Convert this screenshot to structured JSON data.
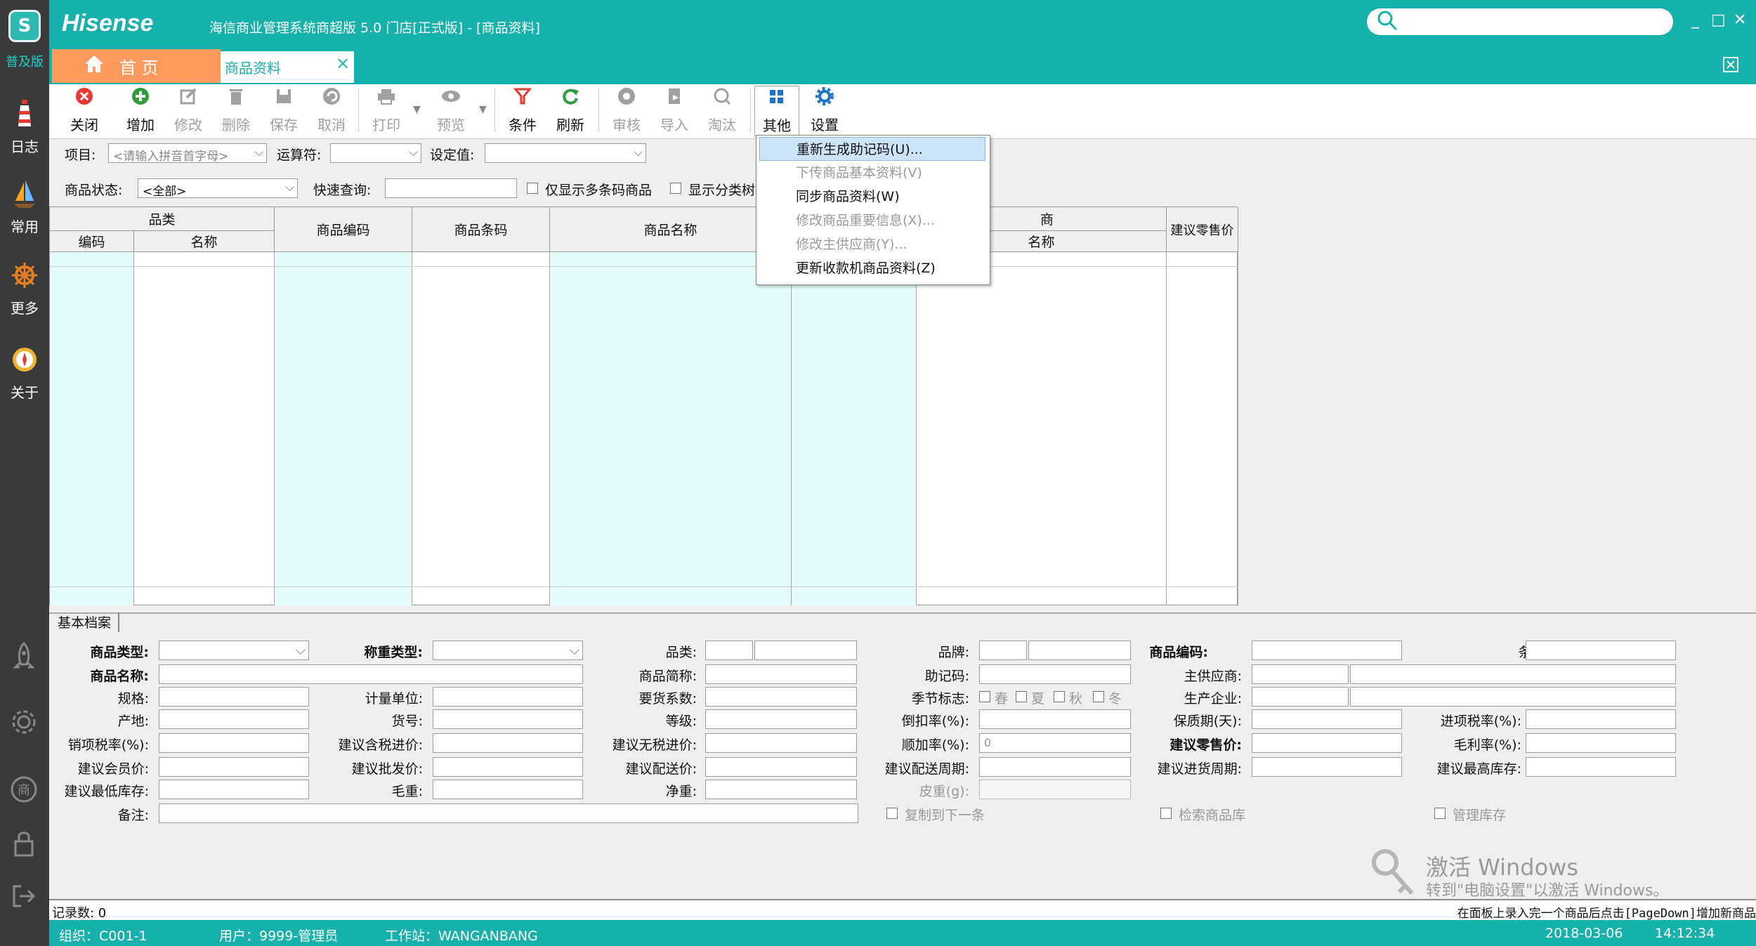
{
  "window": {
    "brand": "Hisense",
    "title": "海信商业管理系统商超版 5.0 门店[正式版] - [商品资料]",
    "search_placeholder": "",
    "minimize": "_",
    "maximize": "□",
    "close": "✕"
  },
  "sidebar": {
    "logo": "S",
    "edition": "普及版",
    "items": [
      {
        "label": "日志",
        "icon": "lighthouse-icon"
      },
      {
        "label": "常用",
        "icon": "sailboat-icon"
      },
      {
        "label": "更多",
        "icon": "helm-icon"
      },
      {
        "label": "关于",
        "icon": "compass-icon"
      }
    ],
    "bottom_icons": [
      "rocket-icon",
      "gear-icon",
      "shop-icon",
      "lock-icon",
      "exit-icon"
    ],
    "shop_glyph": "商"
  },
  "tabs": {
    "home": "首 页",
    "current": "商品资料",
    "close": "×"
  },
  "toolbar": {
    "items": [
      {
        "label": "关闭",
        "icon": "close-circle-icon",
        "enabled": true
      },
      {
        "label": "增加",
        "icon": "add-icon",
        "enabled": true
      },
      {
        "label": "修改",
        "icon": "edit-icon",
        "enabled": false
      },
      {
        "label": "删除",
        "icon": "trash-icon",
        "enabled": false
      },
      {
        "label": "保存",
        "icon": "save-icon",
        "enabled": false
      },
      {
        "label": "取消",
        "icon": "undo-icon",
        "enabled": false
      },
      {
        "label": "打印",
        "icon": "printer-icon",
        "enabled": false
      },
      {
        "label": "预览",
        "icon": "eye-icon",
        "enabled": false
      },
      {
        "label": "条件",
        "icon": "filter-icon",
        "enabled": true
      },
      {
        "label": "刷新",
        "icon": "refresh-icon",
        "enabled": true
      },
      {
        "label": "审核",
        "icon": "audit-icon",
        "enabled": false
      },
      {
        "label": "导入",
        "icon": "import-icon",
        "enabled": false
      },
      {
        "label": "淘汰",
        "icon": "search-icon",
        "enabled": false
      },
      {
        "label": "其他",
        "icon": "grid-icon",
        "enabled": true
      },
      {
        "label": "设置",
        "icon": "gear-icon",
        "enabled": true
      }
    ],
    "colors": {
      "red": "#e53935",
      "green": "#2e9d3a",
      "gray": "#a0a0a0",
      "blue": "#1e74c8"
    }
  },
  "filter": {
    "project_label": "项目:",
    "project_placeholder": "<请输入拼音首字母>",
    "operator_label": "运算符:",
    "operator_value": "",
    "value_label": "设定值:",
    "value_value": "",
    "status_label": "商品状态:",
    "status_value": "<全部>",
    "quick_label": "快速查询:",
    "quick_value": "",
    "multi_barcode": "仅显示多条码商品",
    "show_tree": "显示分类树"
  },
  "grid": {
    "group_category": "品类",
    "col_code": "编码",
    "col_name": "名称",
    "col_product_code": "商品编码",
    "col_barcode": "商品条码",
    "col_product_name": "商品名称",
    "group_supplier": "商",
    "col_supplier_name": "名称",
    "col_price": "建议零售价"
  },
  "menu": {
    "items": [
      {
        "label": "重新生成助记码(U)...",
        "enabled": true,
        "highlighted": true
      },
      {
        "label": "下传商品基本资料(V)",
        "enabled": false
      },
      {
        "label": "同步商品资料(W)",
        "enabled": true
      },
      {
        "label": "修改商品重要信息(X)...",
        "enabled": false
      },
      {
        "label": "修改主供应商(Y)...",
        "enabled": false
      },
      {
        "label": "更新收款机商品资料(Z)",
        "enabled": true
      }
    ]
  },
  "detail": {
    "tab": "基本档案",
    "labels": {
      "product_type": "商品类型:",
      "weigh_type": "称重类型:",
      "category": "品类:",
      "brand": "品牌:",
      "product_code": "商品编码:",
      "barcode": "条码:",
      "product_name": "商品名称:",
      "short_name": "商品简称:",
      "mnemonic": "助记码:",
      "main_supplier": "主供应商:",
      "spec": "规格:",
      "unit": "计量单位:",
      "conversion": "要货系数:",
      "season": "季节标志:",
      "manufacturer": "生产企业:",
      "origin": "产地:",
      "article_no": "货号:",
      "grade": "等级:",
      "deduct_rate": "倒扣率(%):",
      "shelf_life": "保质期(天):",
      "input_tax": "进项税率(%):",
      "output_tax": "销项税率(%):",
      "tax_purchase": "建议含税进价:",
      "notax_purchase": "建议无税进价:",
      "markup_rate": "顺加率(%):",
      "retail_price": "建议零售价:",
      "gross_rate": "毛利率(%):",
      "member_price": "建议会员价:",
      "wholesale_price": "建议批发价:",
      "delivery_price": "建议配送价:",
      "delivery_cycle": "建议配送周期:",
      "purchase_cycle": "建议进货周期:",
      "max_stock": "建议最高库存:",
      "min_stock": "建议最低库存:",
      "gross_weight": "毛重:",
      "net_weight": "净重:",
      "tare": "皮重(g):",
      "remark": "备注:"
    },
    "seasons": [
      "春",
      "夏",
      "秋",
      "冬"
    ],
    "markup_value": "0",
    "copy_next": "复制到下一条",
    "check_store": "检索商品库",
    "manage_stock": "管理库存"
  },
  "watermark": {
    "line1": "激活 Windows",
    "line2": "转到\"电脑设置\"以激活 Windows。"
  },
  "status": {
    "records": "记录数: 0",
    "hint": "在面板上录入完一个商品后点击[PageDown]增加新商品",
    "org": "组织：C001-1",
    "user": "用户：9999-管理员",
    "workstation": "工作站：WANGANBANG",
    "date": "2018-03-06",
    "time": "14:12:34"
  }
}
